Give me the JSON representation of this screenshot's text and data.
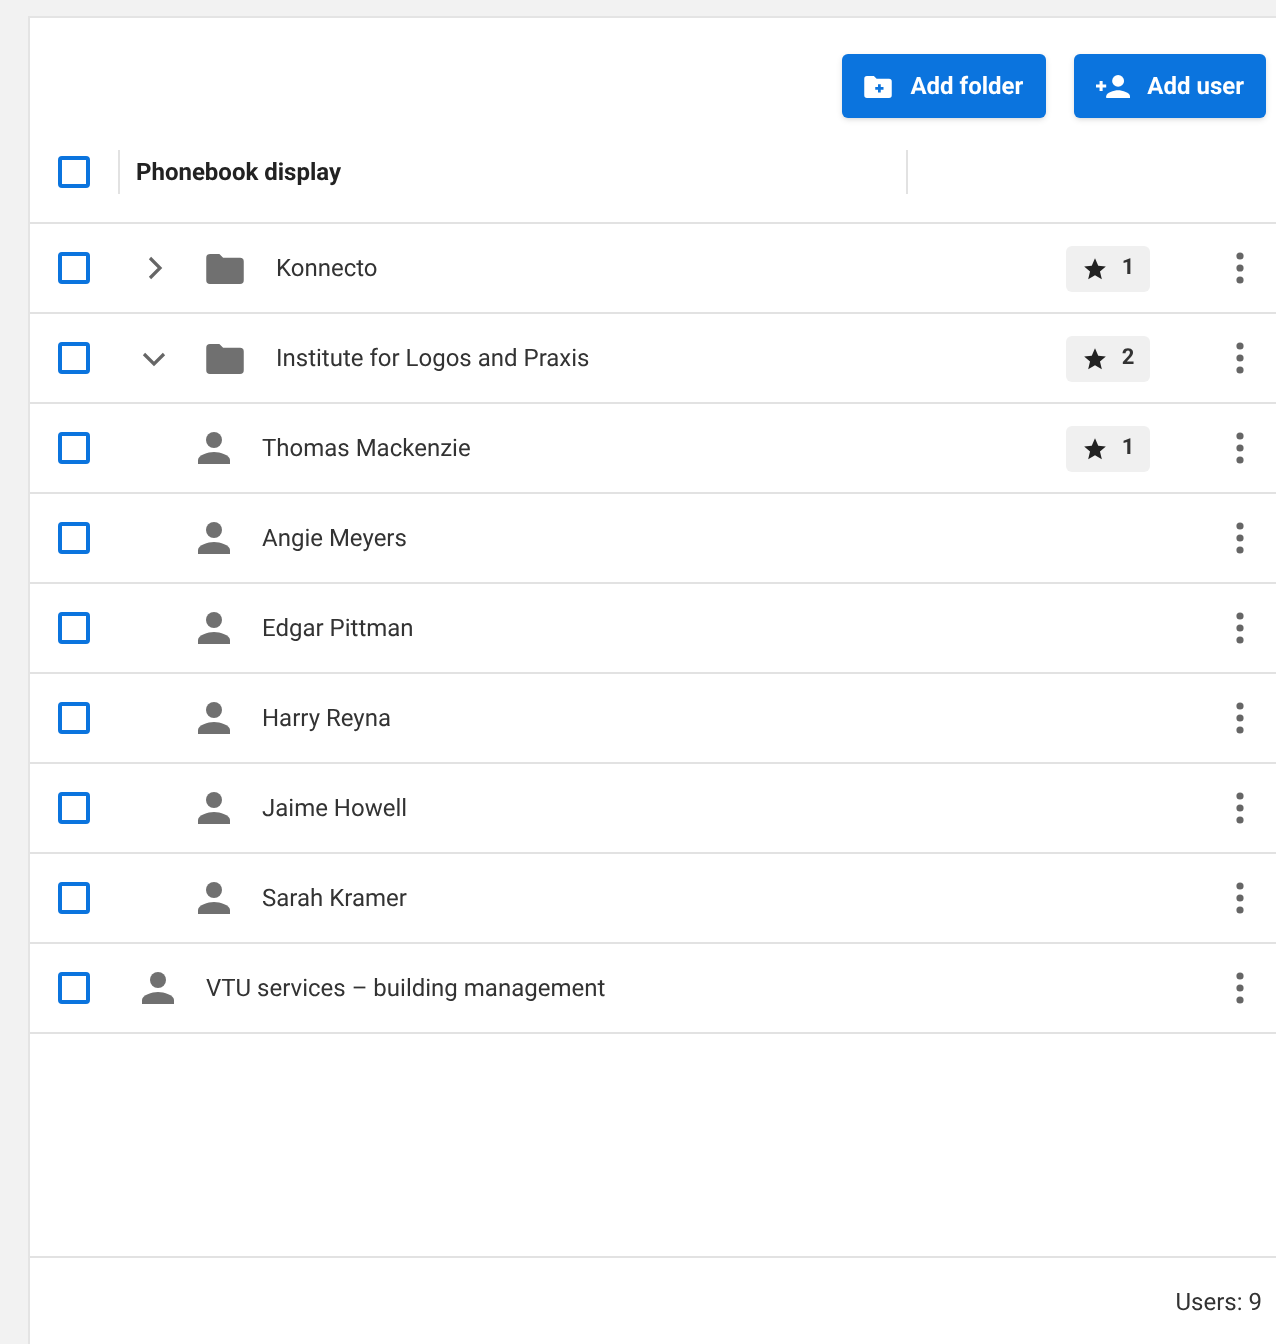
{
  "toolbar": {
    "buttons": [
      {
        "kind": "folder",
        "label": "Add folder"
      },
      {
        "kind": "user",
        "label": "Add user"
      }
    ]
  },
  "table": {
    "header": {
      "checked": false,
      "label": "Phonebook display"
    },
    "rows": [
      {
        "kind": "folder",
        "name": "Konnecto",
        "checked": false,
        "expanded": false,
        "favorites": "1"
      },
      {
        "kind": "folder",
        "name": "Institute for Logos and Praxis",
        "checked": false,
        "expanded": true,
        "favorites": "2",
        "children": [
          {
            "kind": "user",
            "name": "Thomas Mackenzie",
            "checked": false,
            "favorites": "1"
          },
          {
            "kind": "user",
            "name": "Angie Meyers",
            "checked": false
          },
          {
            "kind": "user",
            "name": "Edgar Pittman",
            "checked": false
          },
          {
            "kind": "user",
            "name": "Harry Reyna",
            "checked": false
          },
          {
            "kind": "user",
            "name": "Jaime Howell",
            "checked": false
          },
          {
            "kind": "user",
            "name": "Sarah Kramer",
            "checked": false
          }
        ]
      },
      {
        "kind": "user",
        "name": "VTU services – building management",
        "checked": false
      }
    ]
  },
  "footer": {
    "count": "Users: 9"
  }
}
